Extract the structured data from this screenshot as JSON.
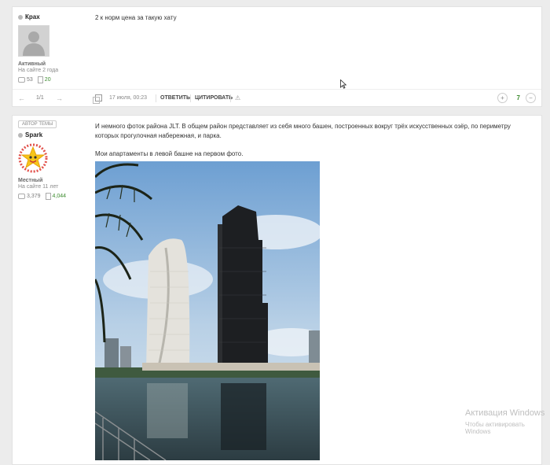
{
  "post1": {
    "author": {
      "name": "Крах",
      "rank": "Активный",
      "since": "На сайте 2 года",
      "posts": "53",
      "likes": "20"
    },
    "text": "2 к норм цена за такую хату",
    "footer": {
      "pager_prev": "←",
      "pager_count": "1/1",
      "pager_next": "→",
      "date": "17 июля, 00:23",
      "reply": "ОТВЕТИТЬ",
      "quote": "ЦИТИРОВАТЬ",
      "report": "⚠",
      "plus": "+",
      "votes": "7",
      "minus": "−"
    }
  },
  "post2": {
    "badge": "АВТОР ТЕМЫ",
    "author": {
      "name": "Spark",
      "rank": "Местный",
      "since": "На сайте 11 лет",
      "posts": "3,379",
      "likes": "4,044"
    },
    "paragraphs": [
      "И немного фоток района JLT. В общем район представляет из себя много башен, построенных вокруг трёх искусственных озёр, по периметру которых прогулочная набережная, и парка.",
      "Мои апартаменты в левой башне на первом фото."
    ]
  },
  "watermark": {
    "line1": "Активация Windows",
    "line2": "Чтобы активировать Windows"
  },
  "colors": {
    "accent_green": "#3d8c2f",
    "page_bg": "#ececec"
  }
}
